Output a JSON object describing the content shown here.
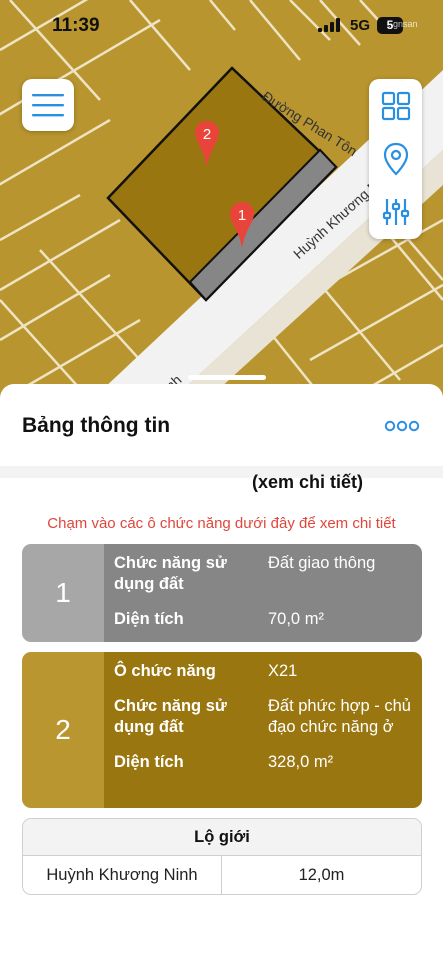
{
  "status_bar": {
    "time": "11:39",
    "network": "5G",
    "battery": "5",
    "watermark": "..gnsan"
  },
  "map": {
    "road_labels": [
      "Đường Phan Tôn",
      "Huỳnh Khương Ni",
      "inh"
    ],
    "markers": [
      {
        "label": "1",
        "color": "#e8443a"
      },
      {
        "label": "2",
        "color": "#e8443a"
      }
    ],
    "colors": {
      "land": "#b8952e",
      "parcel_mixed": "#9a7610",
      "parcel_road": "#868686",
      "road": "#f2f2f2",
      "lot_lines": "#ffffff"
    },
    "buttons": {
      "menu": "hamburger-icon",
      "grid": "grid-icon",
      "location": "location-pin-icon",
      "filter": "sliders-icon"
    },
    "accent": "#2b8fe0"
  },
  "sheet": {
    "title": "Bảng thông tin",
    "more_label": "•••",
    "view_detail": "(xem chi tiết)",
    "hint": "Chạm vào các ô chức năng dưới đây để xem chi tiết",
    "cards": [
      {
        "number": "1",
        "rows": [
          {
            "key": "Chức năng sử dụng đất",
            "value": "Đất giao thông"
          },
          {
            "key": "Diện tích",
            "value": "70,0 m²"
          }
        ]
      },
      {
        "number": "2",
        "rows": [
          {
            "key": "Ô chức năng",
            "value": "X21"
          },
          {
            "key": "Chức năng sử dụng đất",
            "value": "Đất phức hợp - chủ đạo chức năng ở"
          },
          {
            "key": "Diện tích",
            "value": "328,0 m²"
          }
        ]
      }
    ],
    "lo_gioi": {
      "header": "Lộ giới",
      "street": "Huỳnh Khương Ninh",
      "width": "12,0m"
    }
  }
}
